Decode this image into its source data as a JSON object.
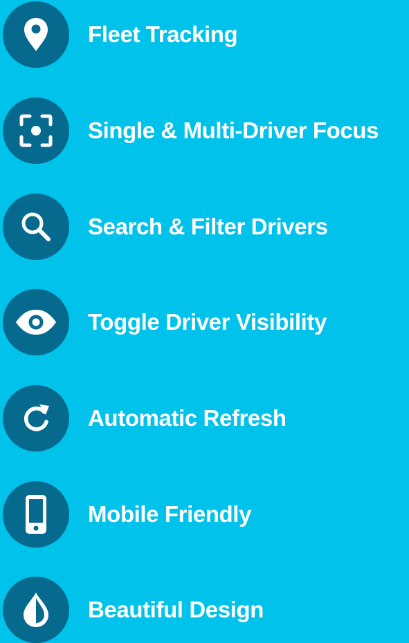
{
  "colors": {
    "background": "#00c2ea",
    "icon_circle": "#066a8f",
    "text": "#ffffff"
  },
  "features": [
    {
      "label": "Fleet Tracking",
      "icon": "map-pin-icon"
    },
    {
      "label": "Single & Multi-Driver Focus",
      "icon": "focus-target-icon"
    },
    {
      "label": "Search & Filter Drivers",
      "icon": "search-icon"
    },
    {
      "label": "Toggle Driver Visibility",
      "icon": "eye-icon"
    },
    {
      "label": "Automatic Refresh",
      "icon": "refresh-icon"
    },
    {
      "label": "Mobile Friendly",
      "icon": "mobile-phone-icon"
    },
    {
      "label": "Beautiful Design",
      "icon": "water-drop-icon"
    }
  ]
}
